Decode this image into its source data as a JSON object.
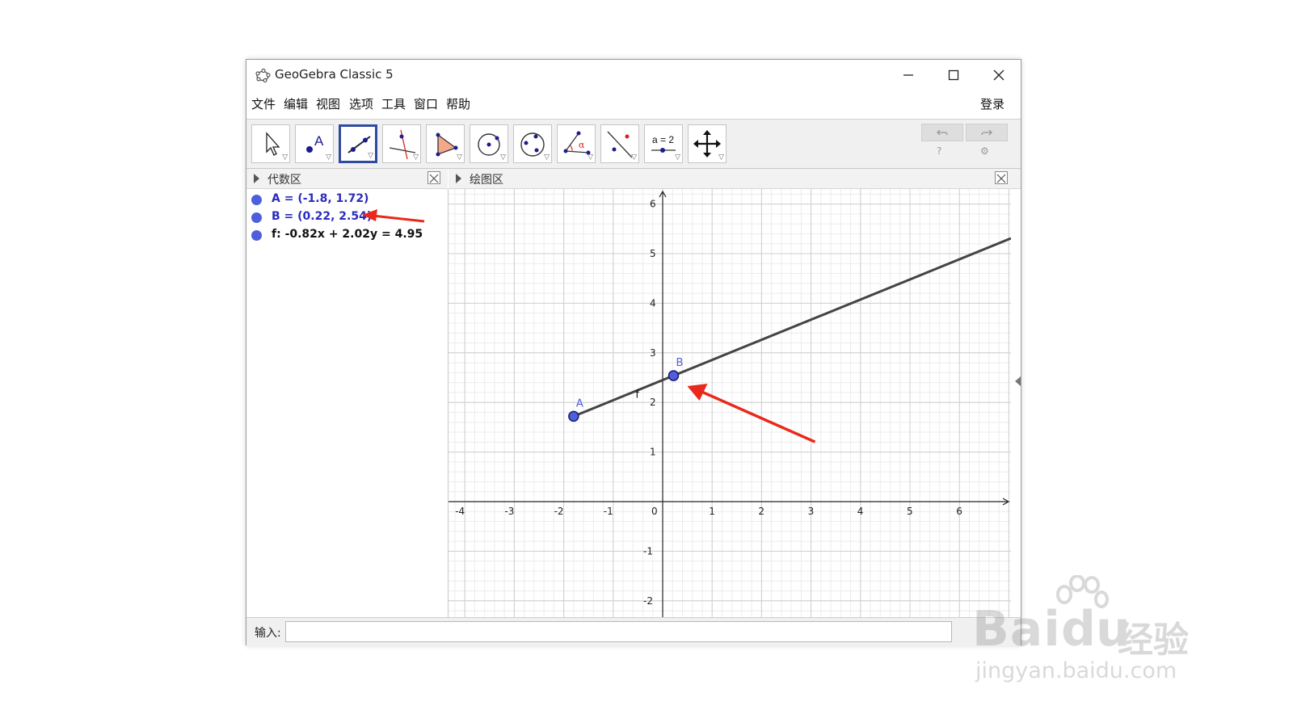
{
  "window": {
    "title": "GeoGebra Classic 5",
    "controls": [
      "minimize",
      "maximize",
      "close"
    ]
  },
  "menubar": {
    "items": [
      "文件",
      "编辑",
      "视图",
      "选项",
      "工具",
      "窗口",
      "帮助"
    ],
    "login": "登录"
  },
  "toolbar": {
    "tools": [
      {
        "icon": "move-arrow-icon",
        "active": false
      },
      {
        "icon": "point-tool-icon",
        "active": false
      },
      {
        "icon": "line-tool-icon",
        "active": true
      },
      {
        "icon": "perpendicular-line-icon",
        "active": false
      },
      {
        "icon": "polygon-tool-icon",
        "active": false
      },
      {
        "icon": "circle-tool-icon",
        "active": false
      },
      {
        "icon": "conic-tool-icon",
        "active": false
      },
      {
        "icon": "angle-tool-icon",
        "active": false
      },
      {
        "icon": "reflect-tool-icon",
        "active": false
      },
      {
        "icon": "slider-tool-icon",
        "active": false
      },
      {
        "icon": "move-graphics-icon",
        "active": false
      }
    ],
    "slider_icon_label": "a = 2",
    "angle_icon_label": "α"
  },
  "algebra": {
    "title": "代数区",
    "items": [
      {
        "text": "A = (-1.8, 1.72)",
        "color": "#2b2bbf"
      },
      {
        "text": "B = (0.22, 2.54)",
        "color": "#2b2bbf"
      },
      {
        "text": "f: -0.82x + 2.02y = 4.95",
        "color": "#111111"
      }
    ]
  },
  "graphics": {
    "title": "绘图区",
    "x_ticks": [
      "-4",
      "-3",
      "-2",
      "-1",
      "0",
      "1",
      "2",
      "3",
      "4",
      "5",
      "6"
    ],
    "y_ticks": [
      "-2",
      "-1",
      "1",
      "2",
      "3",
      "4",
      "5",
      "6"
    ],
    "point_A": {
      "label": "A",
      "x": -1.8,
      "y": 1.72
    },
    "point_B": {
      "label": "B",
      "x": 0.22,
      "y": 2.54
    },
    "line_label": "f",
    "point_color": "#4d5fdc",
    "line_color": "#444444",
    "annotation_color": "#e8291c"
  },
  "inputbar": {
    "label": "输入:"
  },
  "watermark": {
    "brand": "Bai",
    "brand_cn": "经验",
    "url": "jingyan.baidu.com"
  }
}
